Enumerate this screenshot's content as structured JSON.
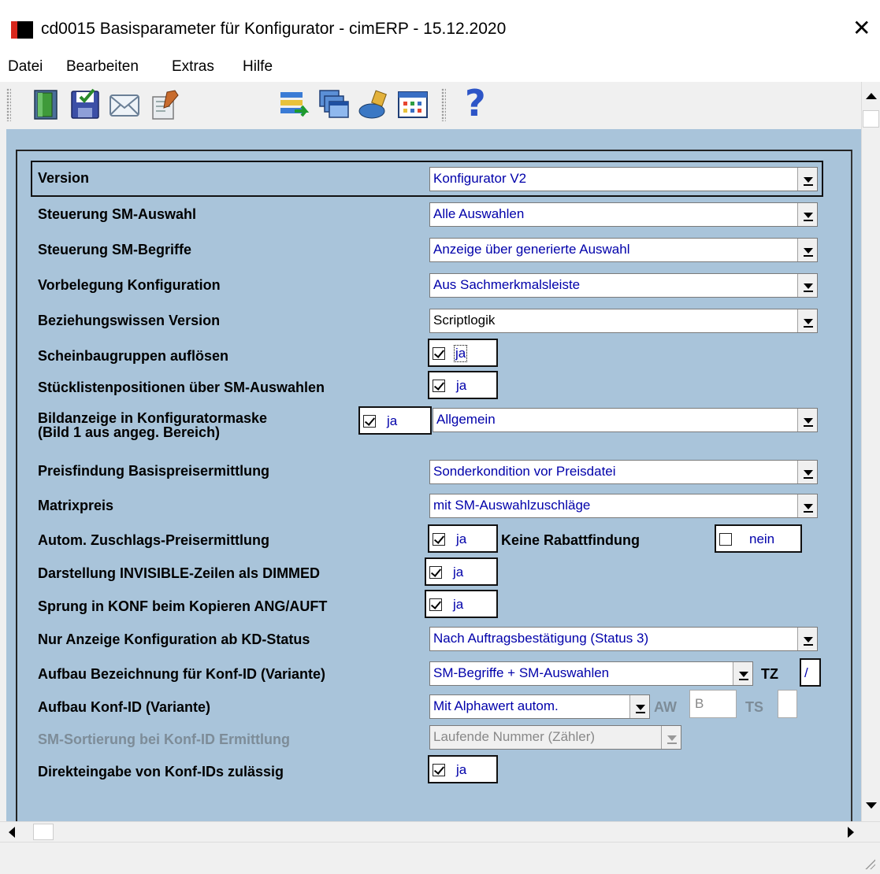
{
  "window": {
    "title": "cd0015 Basisparameter für Konfigurator - cimERP - 15.12.2020",
    "close_glyph": "✕"
  },
  "menu": [
    "Datei",
    "Bearbeiten",
    "Extras",
    "Hilfe"
  ],
  "toolbar": {
    "icons": [
      "exit-door-icon",
      "save-icon",
      "mail-icon",
      "edit-icon",
      "list-export-icon",
      "windows-icon",
      "install-icon",
      "table-icon",
      "help-icon"
    ],
    "help_glyph": "?"
  },
  "colors": {
    "form_background": "#a9c4da",
    "value_text": "#0000aa",
    "brand_red": "#d8271c"
  },
  "form": {
    "version": {
      "label": "Version",
      "value": "Konfigurator V2"
    },
    "sm_auswahl": {
      "label": "Steuerung SM-Auswahl",
      "value": "Alle Auswahlen"
    },
    "sm_begriffe": {
      "label": "Steuerung SM-Begriffe",
      "value": "Anzeige über generierte Auswahl"
    },
    "vorbelegung": {
      "label": "Vorbelegung Konfiguration",
      "value": "Aus Sachmerkmalsleiste"
    },
    "beziehungswissen": {
      "label": "Beziehungswissen Version",
      "value": "Scriptlogik"
    },
    "scheinbaugruppen": {
      "label": "Scheinbaugruppen auflösen",
      "checked": true,
      "text": "ja"
    },
    "stuecklisten": {
      "label": "Stücklistenpositionen über SM-Auswahlen",
      "checked": true,
      "text": "ja"
    },
    "bildanzeige": {
      "label_line1": "Bildanzeige in Konfiguratormaske",
      "label_line2": "(Bild 1 aus angeg. Bereich)",
      "checked": true,
      "text": "ja",
      "value": "Allgemein"
    },
    "preisfindung": {
      "label": "Preisfindung Basispreisermittlung",
      "value": "Sonderkondition vor Preisdatei"
    },
    "matrixpreis": {
      "label": "Matrixpreis",
      "value": "mit SM-Auswahlzuschläge"
    },
    "zuschlag": {
      "label": "Autom. Zuschlags-Preisermittlung",
      "checked": true,
      "text": "ja"
    },
    "rabatt": {
      "label": "Keine Rabattfindung",
      "checked": false,
      "text": "nein"
    },
    "invisible": {
      "label": "Darstellung INVISIBLE-Zeilen als DIMMED",
      "checked": true,
      "text": "ja"
    },
    "sprung": {
      "label": "Sprung in KONF beim Kopieren ANG/AUFT",
      "checked": true,
      "text": "ja"
    },
    "nur_anzeige": {
      "label": "Nur Anzeige Konfiguration ab KD-Status",
      "value": "Nach Auftragsbestätigung (Status 3)"
    },
    "aufbau_bez": {
      "label": "Aufbau Bezeichnung für Konf-ID (Variante)",
      "value": "SM-Begriffe + SM-Auswahlen",
      "tz_label": "TZ",
      "tz_value": "/"
    },
    "aufbau_konf": {
      "label": "Aufbau Konf-ID (Variante)",
      "value": "Mit Alphawert autom.",
      "aw_label": "AW",
      "aw_value": "B",
      "ts_label": "TS",
      "ts_value": ""
    },
    "sortierung": {
      "label": "SM-Sortierung bei Konf-ID Ermittlung",
      "value": "Laufende Nummer (Zähler)"
    },
    "direkteingabe": {
      "label": "Direkteingabe von Konf-IDs zulässig",
      "checked": true,
      "text": "ja"
    }
  }
}
